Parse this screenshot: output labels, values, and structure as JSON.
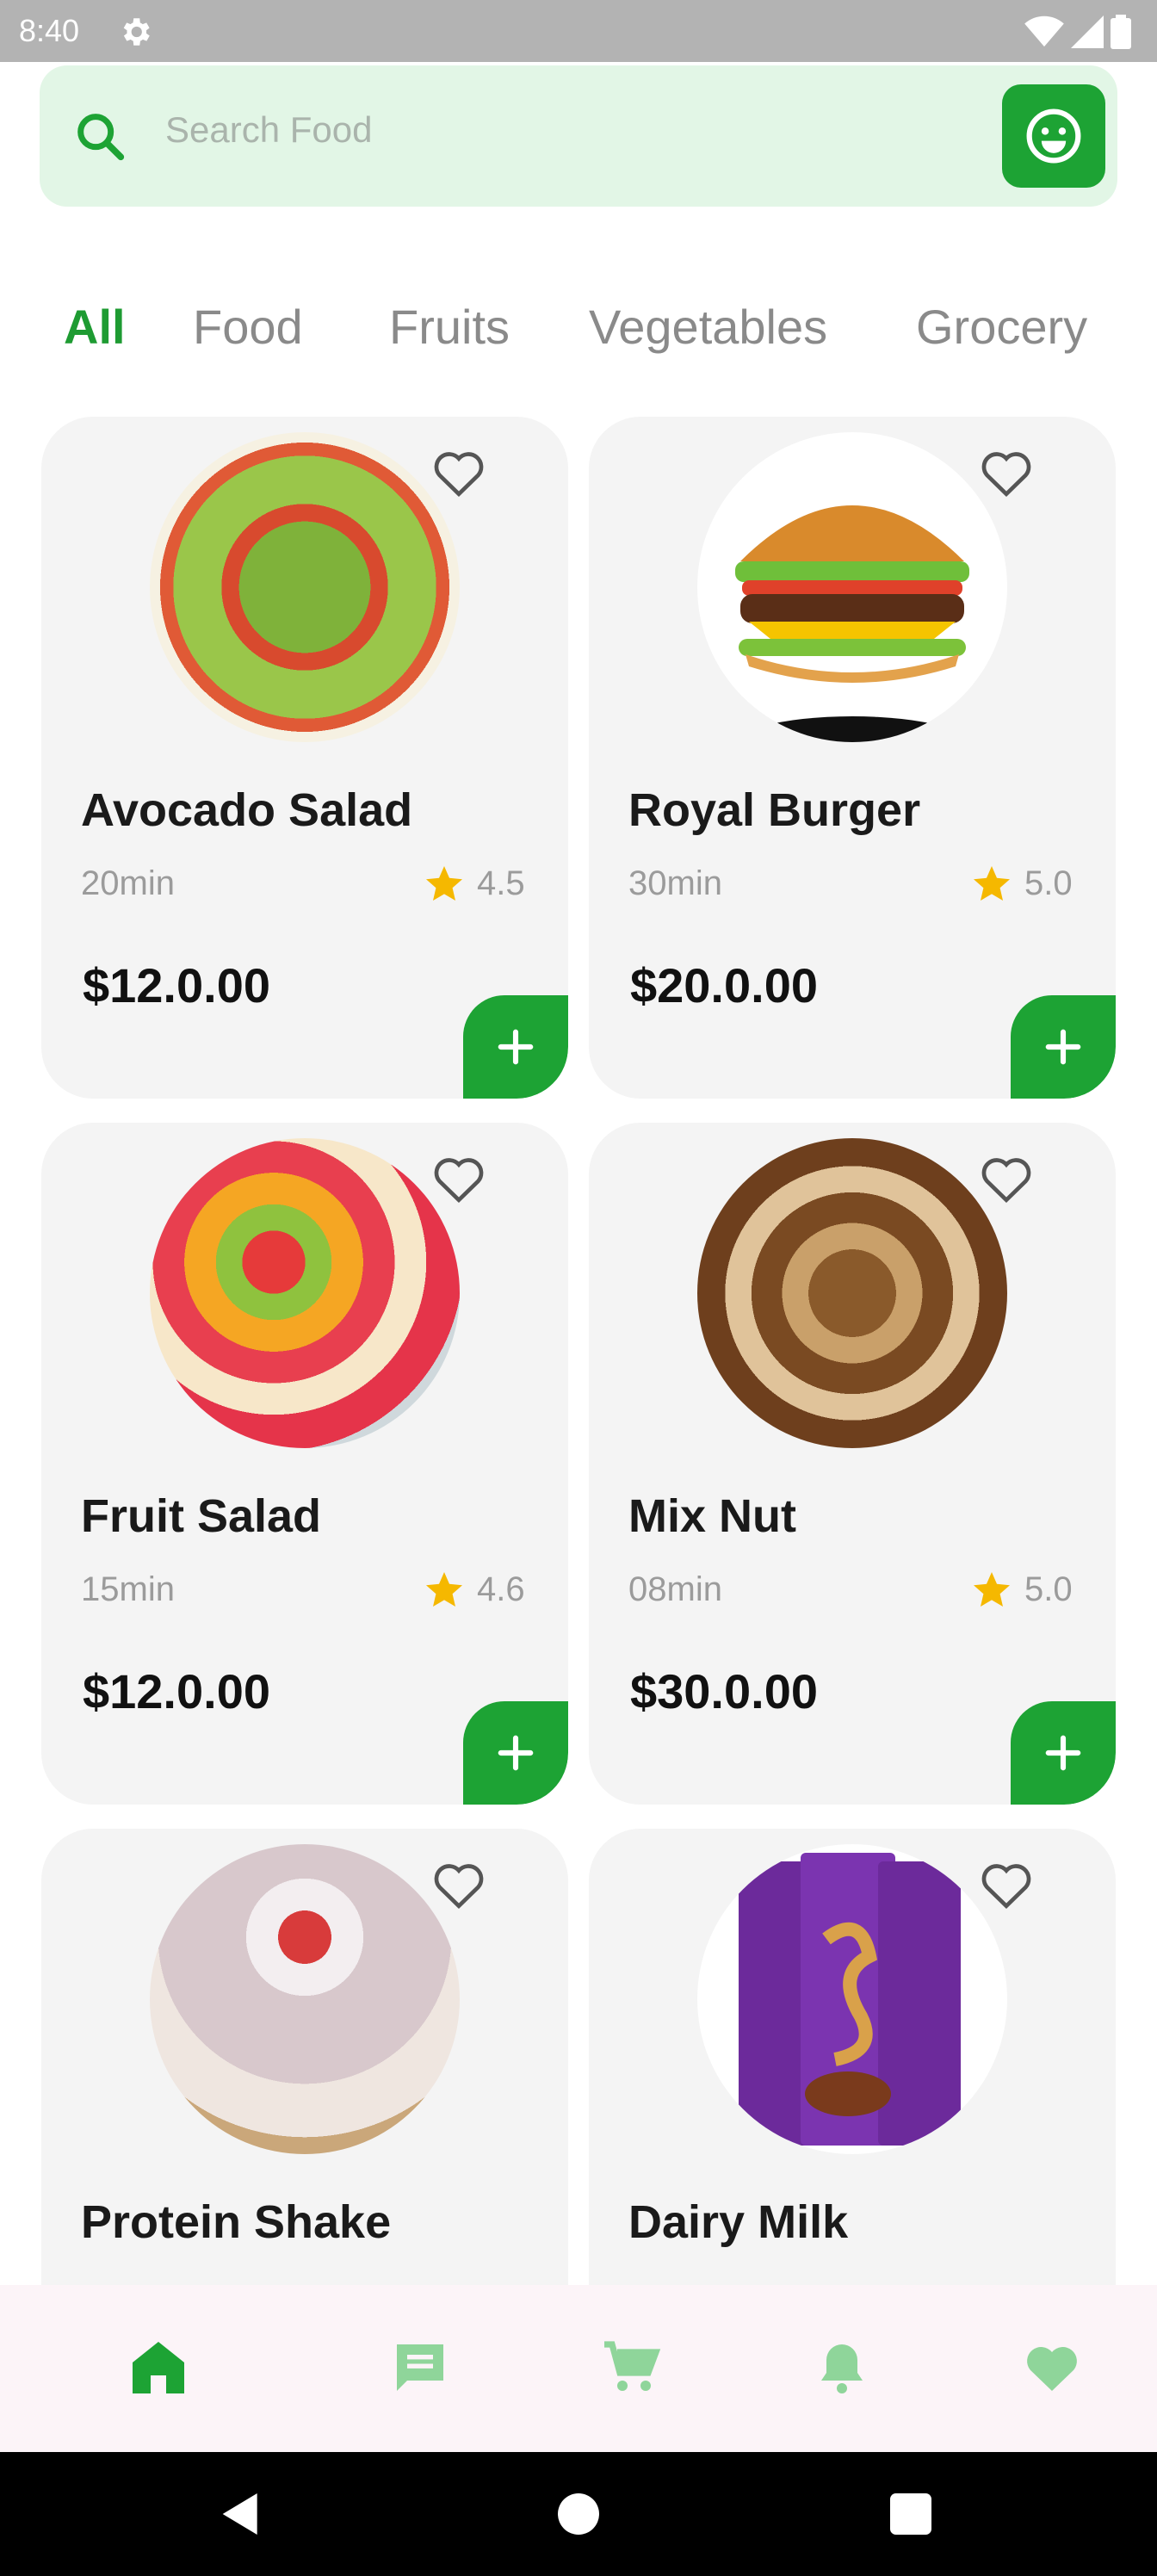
{
  "status": {
    "time": "8:40"
  },
  "search": {
    "placeholder": "Search Food",
    "value": ""
  },
  "tabs": [
    {
      "label": "All",
      "active": true
    },
    {
      "label": "Food",
      "active": false
    },
    {
      "label": "Fruits",
      "active": false
    },
    {
      "label": "Vegetables",
      "active": false
    },
    {
      "label": "Grocery",
      "active": false
    }
  ],
  "products": [
    {
      "name": "Avocado Salad",
      "time": "20min",
      "rating": "4.5",
      "price": "$12.0.00",
      "image": "avocado-salad-image"
    },
    {
      "name": "Royal Burger",
      "time": "30min",
      "rating": "5.0",
      "price": "$20.0.00",
      "image": "burger-image"
    },
    {
      "name": "Fruit Salad",
      "time": "15min",
      "rating": "4.6",
      "price": "$12.0.00",
      "image": "fruit-salad-image"
    },
    {
      "name": "Mix Nut",
      "time": "08min",
      "rating": "5.0",
      "price": "$30.0.00",
      "image": "mixed-nuts-image"
    },
    {
      "name": "Protein Shake",
      "time": "",
      "rating": "",
      "price": "",
      "image": "protein-shake-image"
    },
    {
      "name": "Dairy Milk",
      "time": "",
      "rating": "",
      "price": "",
      "image": "chocolate-bar-image"
    }
  ],
  "bottom_nav": [
    {
      "icon": "home-icon",
      "active": true
    },
    {
      "icon": "chat-icon",
      "active": false
    },
    {
      "icon": "cart-icon",
      "active": false
    },
    {
      "icon": "bell-icon",
      "active": false
    },
    {
      "icon": "heart-icon",
      "active": false
    }
  ],
  "colors": {
    "accent": "#1da334",
    "tab_active": "#1e9b32",
    "search_bg": "#e2f6e6",
    "card_bg": "#f4f4f4",
    "star": "#f5b800",
    "nav_bg": "#fcf4f8"
  }
}
